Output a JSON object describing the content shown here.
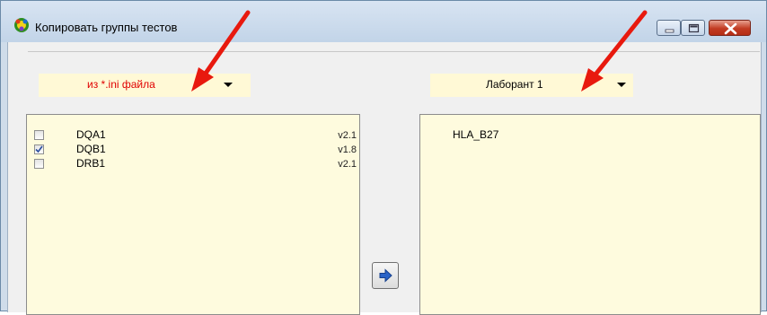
{
  "window": {
    "title": "Копировать группы тестов",
    "icons": {
      "app": "app-icon",
      "minimize": "minimize-icon",
      "maximize": "maximize-icon",
      "close": "close-icon"
    }
  },
  "source_combo": {
    "value": "из *.ini файла",
    "text_color": "#e00000"
  },
  "target_combo": {
    "value": "Лаборант 1"
  },
  "source_list": {
    "items": [
      {
        "name": "DQA1",
        "version": "v2.1",
        "checked": false
      },
      {
        "name": "DQB1",
        "version": "v1.8",
        "checked": true
      },
      {
        "name": "DRB1",
        "version": "v2.1",
        "checked": false
      }
    ]
  },
  "target_list": {
    "items": [
      {
        "name": "HLA_B27"
      }
    ]
  },
  "copy_button": {
    "icon": "arrow-right-icon"
  },
  "annotation": {
    "arrow_color": "#e8190e"
  }
}
